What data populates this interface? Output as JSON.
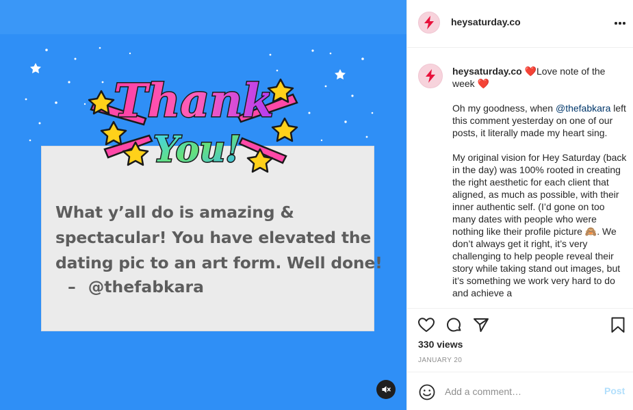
{
  "post": {
    "username": "heysaturday.co",
    "more_icon": "more-horizontal-icon"
  },
  "media": {
    "quote_lines": [
      "What y’all do is amazing &",
      "spectacular! You have elevated the",
      "dating pic to an art form. Well done!"
    ],
    "quote_dash": "–",
    "quote_author": "@thefabkara",
    "artwork_text": "Thank You!",
    "mute_icon": "volume-muted-icon",
    "colors": {
      "background": "#2f8ff6",
      "card": "#ebebeb"
    }
  },
  "caption": {
    "username": "heysaturday.co",
    "heart": "❤️",
    "headline": "Love note of the week",
    "heart_end": "❤️",
    "p1_before": "Oh my goodness, when ",
    "p1_mention": "@thefabkara",
    "p1_after": " left this comment yesterday on one of our posts, it literally made my heart sing.",
    "p2": "My original vision for Hey Saturday (back in the day) was 100% rooted in creating the right aesthetic for each client that aligned, as much as possible, with their inner authentic self. (I’d gone on too many dates with people who were nothing like their profile picture 🙈. We don’t always get it right, it’s very challenging to help people reveal their story while taking stand out images, but it’s something we work very hard to do and achieve a"
  },
  "actions": {
    "like_icon": "heart-outline-icon",
    "comment_icon": "comment-bubble-icon",
    "share_icon": "paper-plane-icon",
    "save_icon": "bookmark-icon",
    "views": "330 views",
    "date": "JANUARY 20"
  },
  "comment_box": {
    "emoji_icon": "smiley-icon",
    "placeholder": "Add a comment…",
    "post_label": "Post"
  }
}
